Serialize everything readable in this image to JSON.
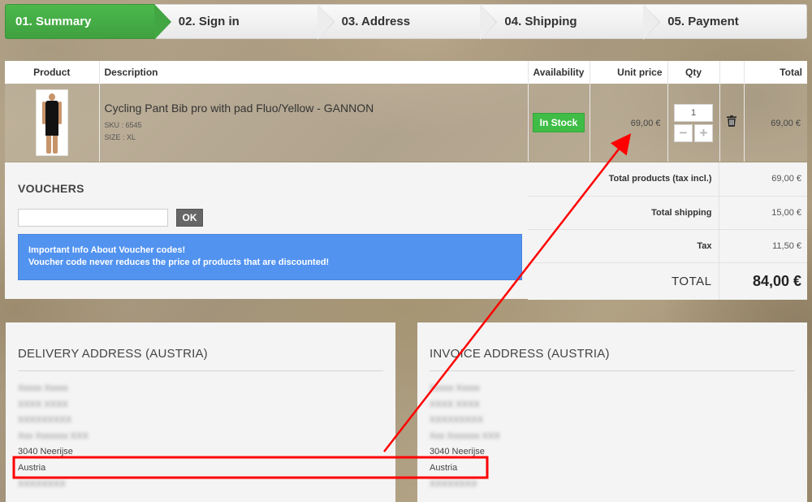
{
  "steps": [
    {
      "label": "01. Summary",
      "active": true
    },
    {
      "label": "02. Sign in"
    },
    {
      "label": "03. Address"
    },
    {
      "label": "04. Shipping"
    },
    {
      "label": "05. Payment"
    }
  ],
  "cart": {
    "headers": {
      "product": "Product",
      "description": "Description",
      "availability": "Availability",
      "unit_price": "Unit price",
      "qty": "Qty",
      "total": "Total"
    },
    "item": {
      "name": "Cycling Pant Bib pro with pad Fluo/Yellow - GANNON",
      "sku": "SKU : 6545",
      "size": "SIZE : XL",
      "availability": "In Stock",
      "unit_price": "69,00 €",
      "qty": "1",
      "qty_minus": "−",
      "qty_plus": "+",
      "total": "69,00 €",
      "delete_icon": "trash-icon"
    }
  },
  "vouchers": {
    "title": "VOUCHERS",
    "ok_label": "OK",
    "info_line1": "Important Info About Voucher codes!",
    "info_line2": "Voucher code never reduces the price of products that are discounted!"
  },
  "totals": {
    "products_label": "Total products (tax incl.)",
    "products_value": "69,00 €",
    "shipping_label": "Total shipping",
    "shipping_value": "15,00 €",
    "tax_label": "Tax",
    "tax_value": "11,50 €",
    "grand_label": "TOTAL",
    "grand_value": "84,00 €"
  },
  "delivery": {
    "title": "DELIVERY ADDRESS (AUSTRIA)",
    "city": "3040 Neerijse",
    "country": "Austria"
  },
  "invoice": {
    "title": "INVOICE ADDRESS (AUSTRIA)",
    "city": "3040 Neerijse",
    "country": "Austria"
  },
  "colors": {
    "step_active": "#42a742",
    "in_stock": "#3fbd46",
    "info_box": "#5293f0",
    "annotation": "#ff0000"
  }
}
